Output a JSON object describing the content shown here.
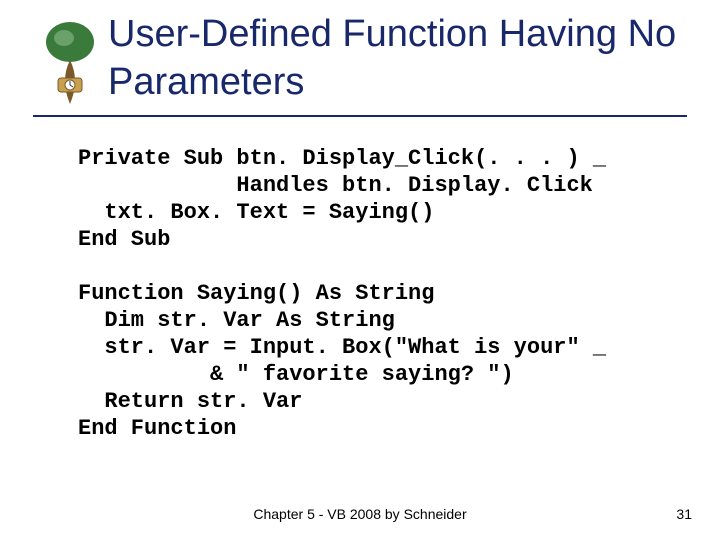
{
  "title": "User-Defined Function Having No Parameters",
  "code": "Private Sub btn. Display_Click(. . . ) _\n            Handles btn. Display. Click\n  txt. Box. Text = Saying()\nEnd Sub\n\nFunction Saying() As String\n  Dim str. Var As String\n  str. Var = Input. Box(\"What is your\" _\n          & \" favorite saying? \")\n  Return str. Var\nEnd Function",
  "footer": "Chapter 5 - VB 2008 by Schneider",
  "page_number": "31"
}
